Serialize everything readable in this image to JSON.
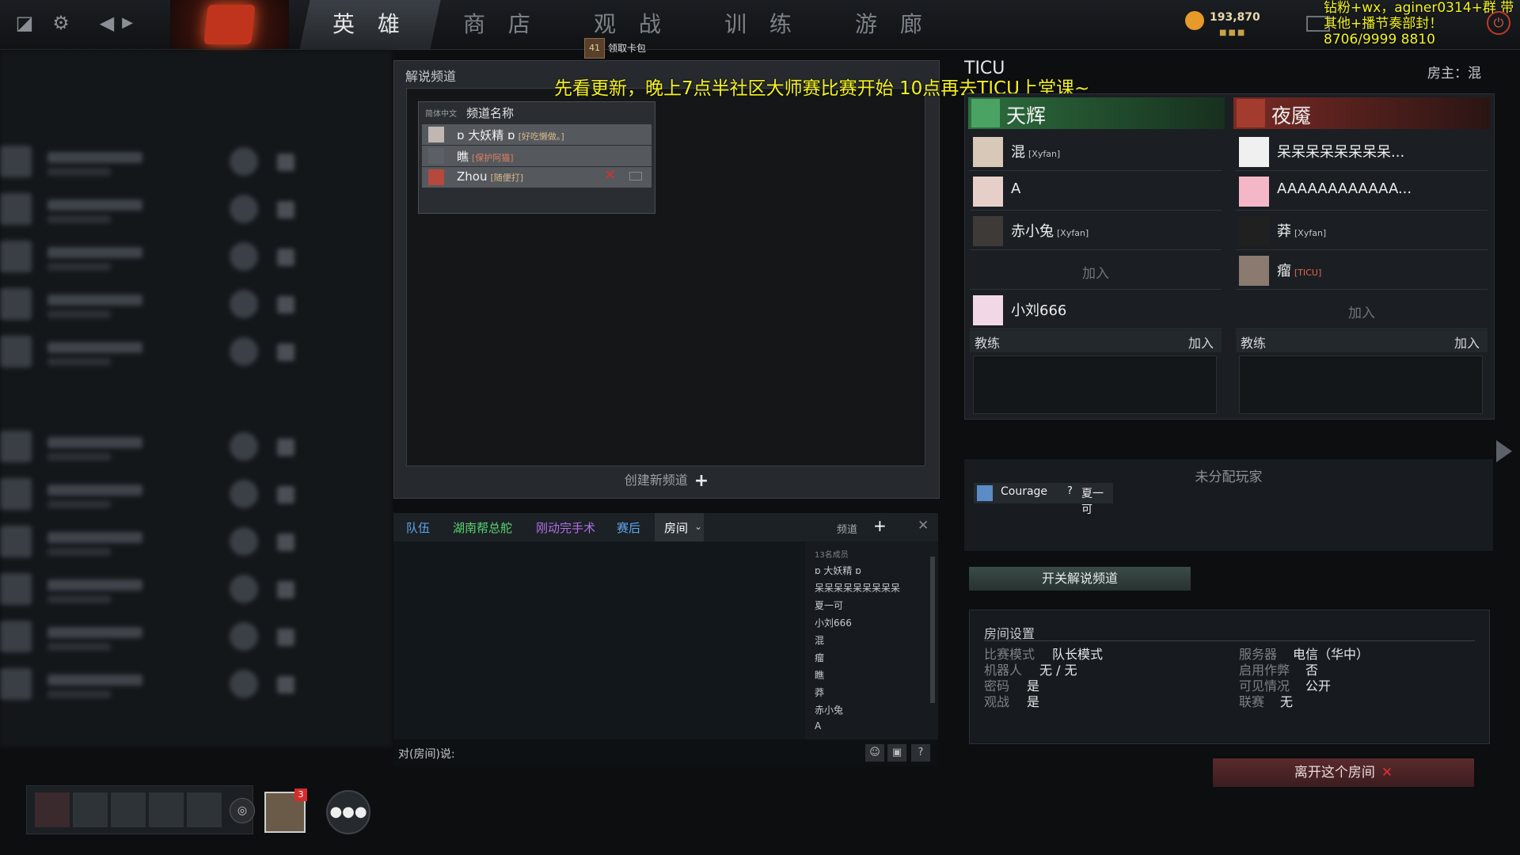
{
  "topbar": {
    "nav": [
      "英 雄",
      "商 店",
      "观 战",
      "训 练",
      "游 廊"
    ],
    "active_nav": "英 雄",
    "coins": "193,870",
    "card_bag_count": "41",
    "card_bag_label": "领取卡包"
  },
  "overlay": {
    "top_right": "钻粉+wx，aginer0314+群 带其他+播节奏部封！ 8706/9999 8810",
    "center": "先看更新，晚上7点半社区大师赛比赛开始 10点再去TICU上堂课~"
  },
  "commentary": {
    "title": "解说频道",
    "header_lang": "简体中文",
    "header_name": "频道名称",
    "channels": [
      {
        "name": "ɒ 大妖精 ɒ",
        "note": "[好吃懒做。]"
      },
      {
        "name": "瞧",
        "note": "[保护阿猫]"
      },
      {
        "name": "Zhou",
        "note": "[随便打]"
      }
    ],
    "create": "创建新频道"
  },
  "chat": {
    "tabs": [
      "队伍",
      "湖南帮总舵",
      "刚动完手术",
      "赛后",
      "房间"
    ],
    "tab_colors": [
      "#5fa6e8",
      "#57d66f",
      "#b06fe3",
      "#5fa6e8",
      "#ffffff"
    ],
    "channel_label": "频道",
    "member_count": "13名成员",
    "members": [
      "ɒ 大妖精 ɒ",
      "呆呆呆呆呆呆呆呆呆",
      "夏一可",
      "小刘666",
      "混",
      "瘤",
      "瞧",
      "莽",
      "赤小兔",
      "A"
    ],
    "say_label": "对(房间)说:"
  },
  "room": {
    "title": "TICU",
    "owner": "房主：混",
    "radiant": {
      "name": "天辉",
      "players": [
        {
          "name": "混",
          "tag": "[Xyfan]"
        },
        {
          "name": "A",
          "tag": ""
        },
        {
          "name": "赤小兔",
          "tag": "[Xyfan]"
        },
        {
          "name": "",
          "tag": ""
        },
        {
          "name": "小刘666",
          "tag": ""
        }
      ],
      "join": "加入"
    },
    "dire": {
      "name": "夜魇",
      "players": [
        {
          "name": "呆呆呆呆呆呆呆呆...",
          "tag": ""
        },
        {
          "name": "AAAAAAAAAAAA...",
          "tag": ""
        },
        {
          "name": "莽",
          "tag": "[Xyfan]"
        },
        {
          "name": "瘤",
          "tag": "[TICU]"
        },
        {
          "name": "",
          "tag": ""
        }
      ],
      "join": "加入"
    },
    "coach_label": "教练",
    "coach_join": "加入",
    "unassigned_title": "未分配玩家",
    "unassigned": [
      "Courage",
      "夏一可"
    ],
    "unassigned_icon_text": "?",
    "commentary_button": "开关解说频道",
    "settings": {
      "title": "房间设置",
      "left": [
        {
          "k": "比赛模式",
          "v": "队长模式"
        },
        {
          "k": "机器人",
          "v": "无 / 无"
        },
        {
          "k": "密码",
          "v": "是"
        },
        {
          "k": "观战",
          "v": "是"
        }
      ],
      "right": [
        {
          "k": "服务器",
          "v": "电信（华中）"
        },
        {
          "k": "启用作弊",
          "v": "否"
        },
        {
          "k": "可见情况",
          "v": "公开"
        },
        {
          "k": "联赛",
          "v": "无"
        }
      ]
    },
    "leave_button": "离开这个房间"
  },
  "party": {
    "friend_badge": "3"
  }
}
